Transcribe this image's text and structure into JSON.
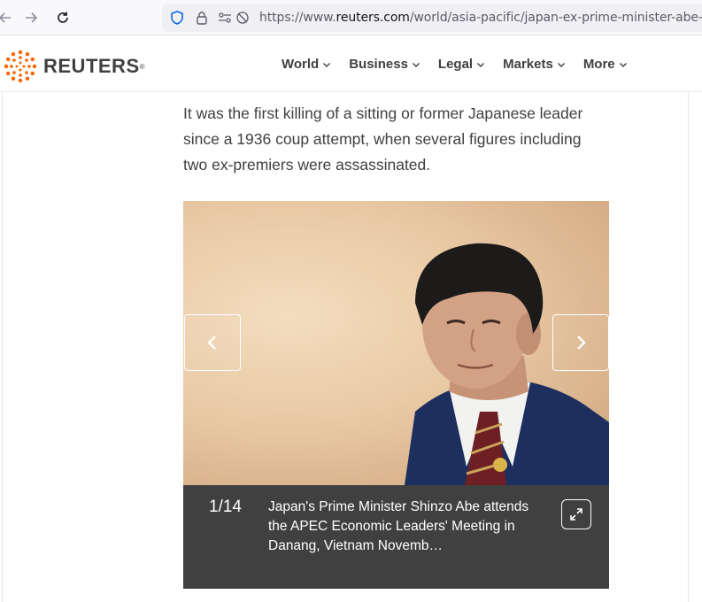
{
  "browser": {
    "url_prefix": "https://www.",
    "url_host": "reuters.com",
    "url_path": "/world/asia-pacific/japan-ex-prime-minister-abe-may-",
    "icons": [
      "back-icon",
      "forward-icon",
      "reload-icon",
      "shield-icon",
      "lock-icon",
      "permissions-icon",
      "tracking-off-icon"
    ]
  },
  "header": {
    "logo_text": "REUTERS",
    "logo_mark": "®",
    "nav": [
      {
        "label": "World"
      },
      {
        "label": "Business"
      },
      {
        "label": "Legal"
      },
      {
        "label": "Markets"
      },
      {
        "label": "More"
      }
    ]
  },
  "article": {
    "paragraph": "It was the first killing of a sitting or former Japanese leader since a 1936 coup attempt, when several figures including two ex-premiers were assassinated."
  },
  "gallery": {
    "counter": "1/14",
    "caption": "Japan's Prime Minister Shinzo Abe attends the APEC Economic Leaders' Meeting in Danang, Vietnam Novemb…",
    "icons": [
      "chevron-left-icon",
      "chevron-right-icon",
      "expand-icon"
    ]
  },
  "colors": {
    "brand_orange": "#fa6400",
    "text": "#404040",
    "caption_bg": "#404040"
  }
}
